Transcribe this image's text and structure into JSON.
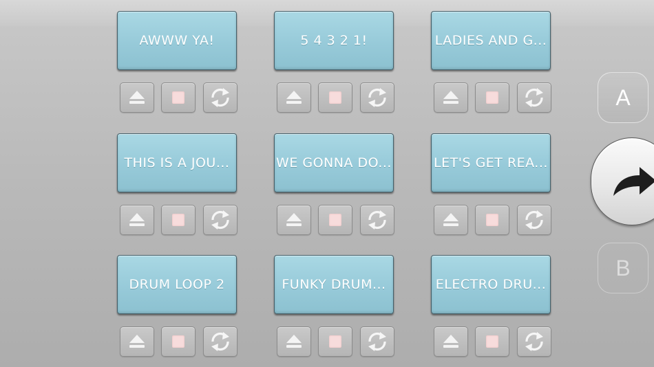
{
  "pads": [
    {
      "label": "AWWW YA!"
    },
    {
      "label": "5 4 3 2 1!"
    },
    {
      "label": "LADIES AND G..."
    },
    {
      "label": "THIS IS A JOU..."
    },
    {
      "label": "WE GONNA DO..."
    },
    {
      "label": "LET'S GET REA..."
    },
    {
      "label": "DRUM LOOP 2"
    },
    {
      "label": "FUNKY DRUM..."
    },
    {
      "label": "ELECTRO DRU..."
    }
  ],
  "controls": [
    "eject-icon",
    "stop-icon",
    "loop-icon"
  ],
  "banks": {
    "a_label": "A",
    "b_label": "B"
  },
  "switch_icon": "share-arrow-icon",
  "colors": {
    "pad": "#9dd0de",
    "pad_text": "#ffffff",
    "stop": "#f7dcdc",
    "background": "#bcbcbc"
  }
}
